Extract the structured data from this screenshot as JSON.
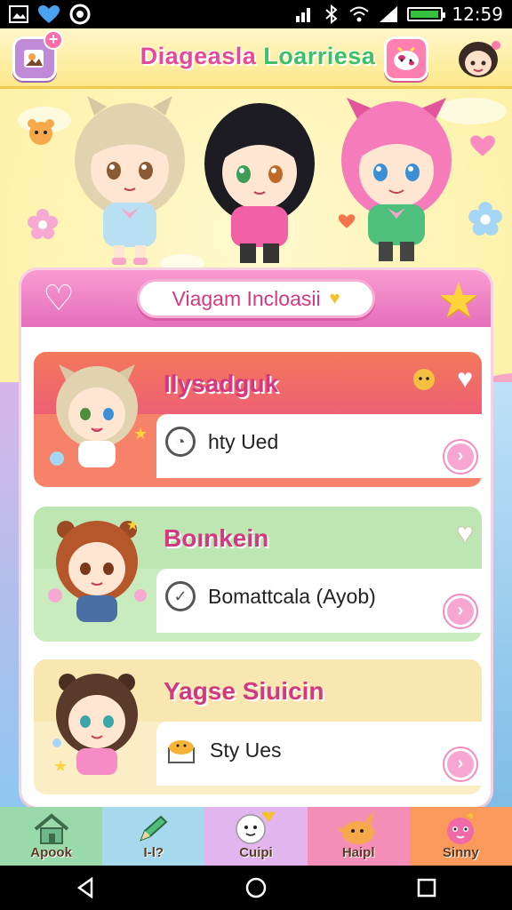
{
  "status_bar": {
    "time": "12:59",
    "battery_level": 0.95
  },
  "header": {
    "title_part1": "Diageasla",
    "title_part2": "Loarriesa",
    "left_icon": "photo-add-icon",
    "right_icon": "cow-face-icon"
  },
  "panel": {
    "title": "Viagam Incloasii"
  },
  "cards": [
    {
      "name": "Ilysadguk",
      "detail": "hty Ued",
      "color": "#f7826a"
    },
    {
      "name": "Boınkein",
      "detail": "Bomattcala (Ayob)",
      "color": "#c8ecbd"
    },
    {
      "name": "Yagse Siuicin",
      "detail": "Sty Ues",
      "color": "#fbeec6"
    }
  ],
  "bottom_nav": [
    {
      "label": "Apook",
      "icon": "house-icon",
      "color": "#9ad9a9"
    },
    {
      "label": "I-l?",
      "icon": "pencil-icon",
      "color": "#a6d9ee"
    },
    {
      "label": "Cuipi",
      "icon": "chat-face-icon",
      "color": "#e2b5ef"
    },
    {
      "label": "Haipl",
      "icon": "pet-icon",
      "color": "#f58eb6"
    },
    {
      "label": "Sinny",
      "icon": "pink-creature-icon",
      "color": "#f99a5c"
    }
  ]
}
